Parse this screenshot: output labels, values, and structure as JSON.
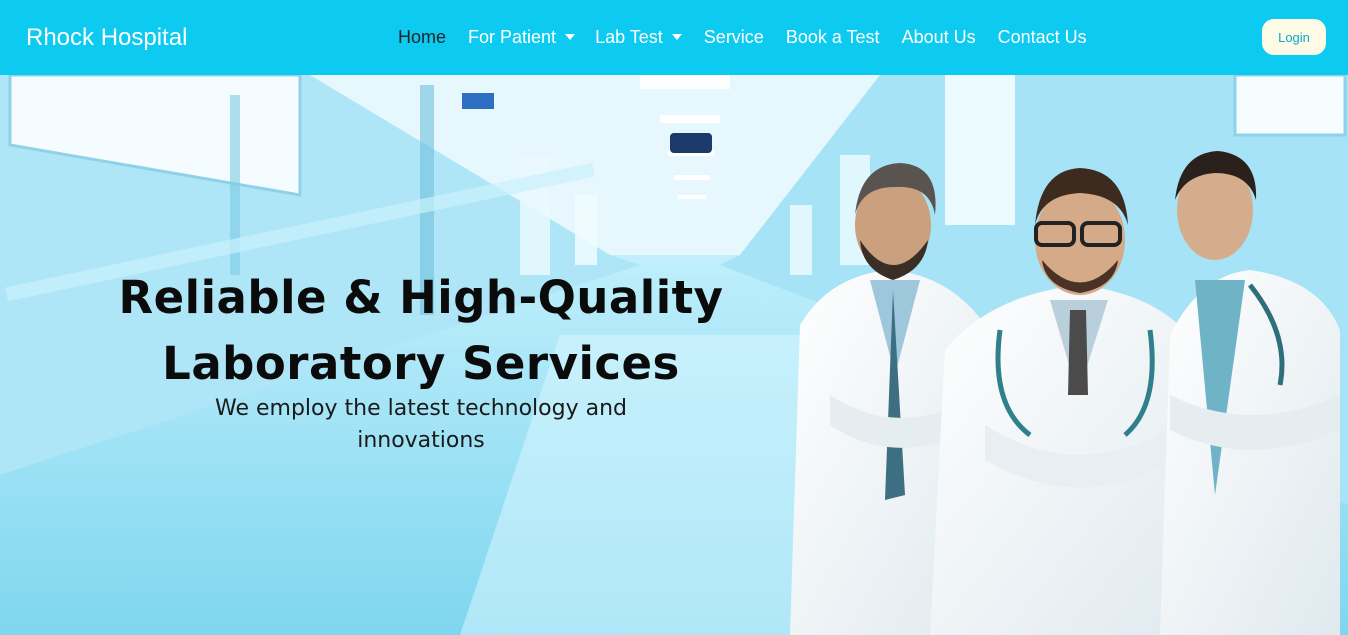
{
  "brand": {
    "name": "Rhock Hospital"
  },
  "nav": {
    "items": [
      {
        "label": "Home",
        "active": true,
        "dropdown": false
      },
      {
        "label": "For Patient",
        "active": false,
        "dropdown": true
      },
      {
        "label": "Lab Test",
        "active": false,
        "dropdown": true
      },
      {
        "label": "Service",
        "active": false,
        "dropdown": false
      },
      {
        "label": "Book a Test",
        "active": false,
        "dropdown": false
      },
      {
        "label": "About Us",
        "active": false,
        "dropdown": false
      },
      {
        "label": "Contact Us",
        "active": false,
        "dropdown": false
      }
    ],
    "login_label": "Login"
  },
  "hero": {
    "headline_line1": "Reliable & High-Quality",
    "headline_line2": "Laboratory Services",
    "subtext_line1": "We employ the latest technology and",
    "subtext_line2": "innovations"
  },
  "colors": {
    "navbar": "#0dcaf0",
    "nav_text": "#ffffff",
    "nav_active": "#212529",
    "login_bg": "#fdfbe6",
    "hero_tint": "#9fe2f6"
  }
}
